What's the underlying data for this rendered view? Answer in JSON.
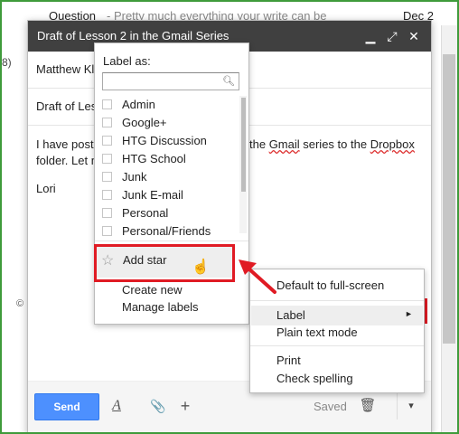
{
  "inbox": {
    "sender": "Question",
    "snippet": "- Pretty much everything your write can be",
    "date": "Dec 2",
    "left_fragment": "8)",
    "copyright_fragment": "©"
  },
  "compose": {
    "title": "Draft of Lesson 2 in the Gmail Series",
    "header_buttons": {
      "minimize": "▁",
      "expand": "⤢",
      "close": "✕"
    },
    "to_value": "Matthew Kl",
    "subject_value": "Draft of Less",
    "body_line1_left": "I have poste",
    "body_line1_right_pre": "the ",
    "body_line1_right_gmail": "Gmail",
    "body_line1_right_mid": " series to the ",
    "body_line1_right_dropbox": "Dropbox",
    "body_line2": "folder. Let m",
    "signature": "Lori",
    "toolbar": {
      "send_label": "Send",
      "format_icon": "A",
      "attach_icon": "📎",
      "insert_icon": "+",
      "saved_label": "Saved",
      "trash_icon": "🗑",
      "more_icon": "▾"
    }
  },
  "label_menu": {
    "title": "Label as:",
    "search_value": "",
    "items": [
      {
        "label": "Admin"
      },
      {
        "label": "Google+"
      },
      {
        "label": "HTG Discussion"
      },
      {
        "label": "HTG School"
      },
      {
        "label": "Junk"
      },
      {
        "label": "Junk E-mail"
      },
      {
        "label": "Personal"
      },
      {
        "label": "Personal/Friends"
      }
    ],
    "add_star": "Add star",
    "create_new": "Create new",
    "manage_labels": "Manage labels"
  },
  "context_menu": {
    "default_fullscreen": "Default to full-screen",
    "label": "Label",
    "plain_text": "Plain text mode",
    "print": "Print",
    "check_spelling": "Check spelling"
  },
  "colors": {
    "highlight_box": "#e01b24",
    "send_button": "#4d90fe",
    "compose_header": "#404040",
    "frame_border": "#3f9b3b"
  }
}
